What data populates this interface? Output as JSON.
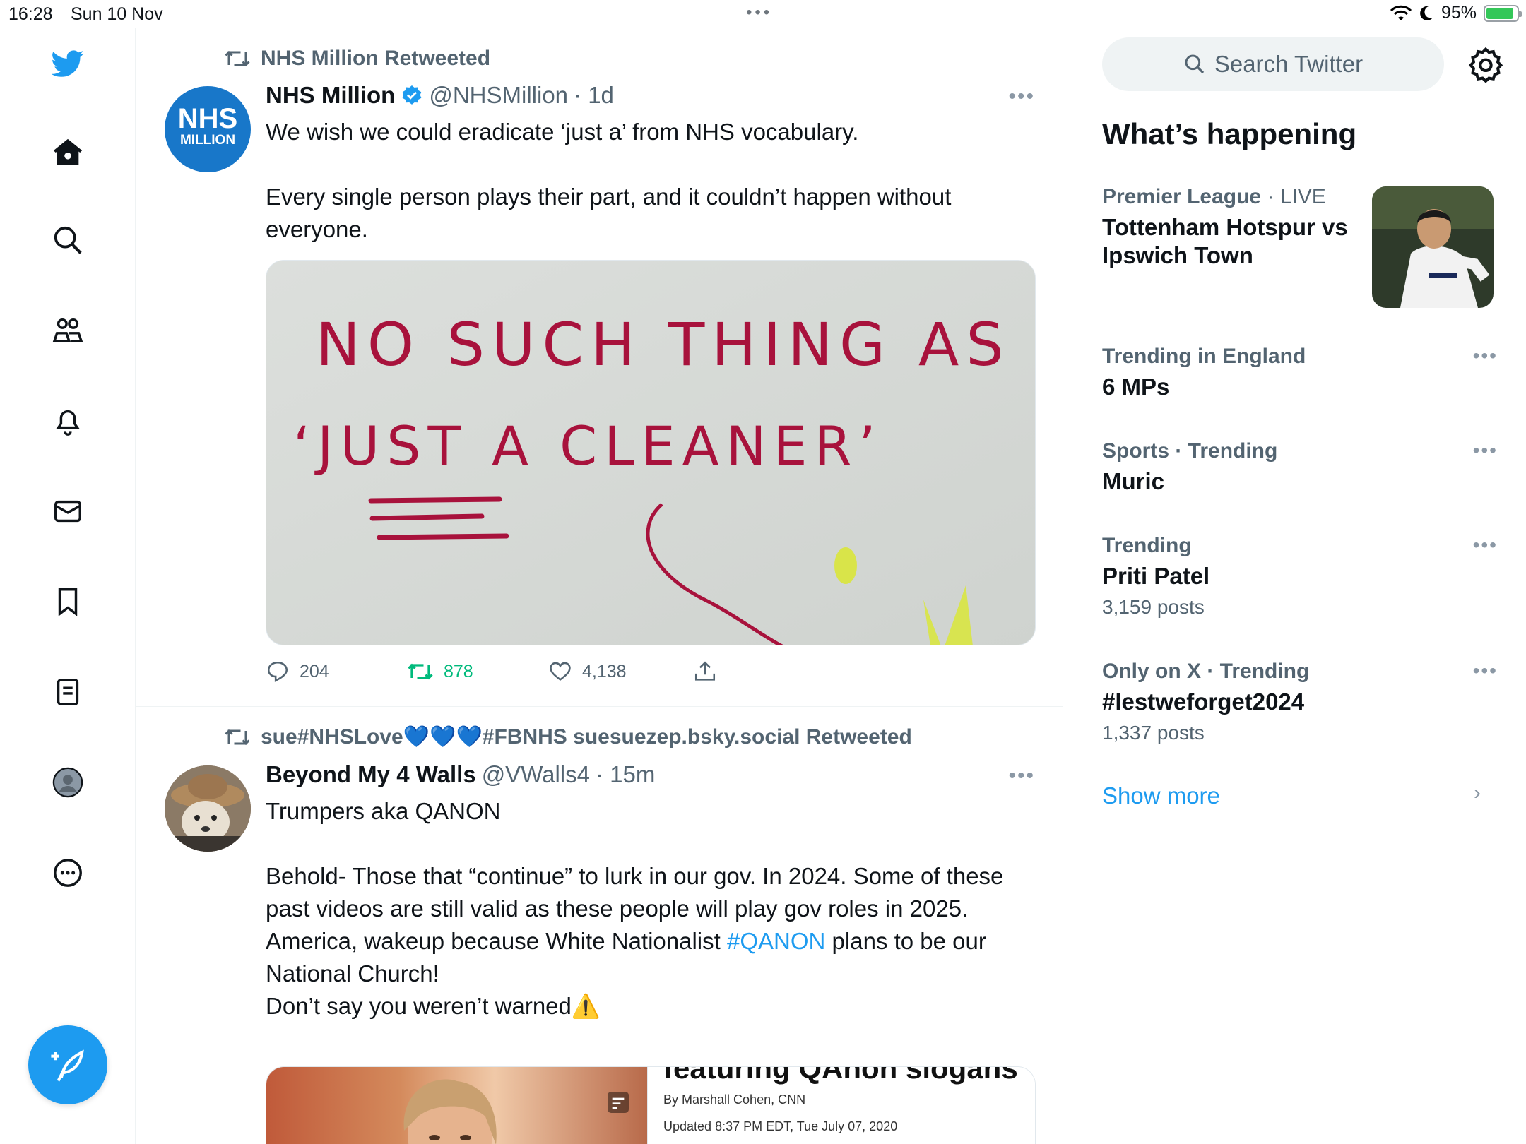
{
  "status_bar": {
    "time": "16:28",
    "date": "Sun 10 Nov",
    "battery": "95%",
    "battery_level": 0.95
  },
  "nav": {
    "items": [
      {
        "name": "home"
      },
      {
        "name": "explore"
      },
      {
        "name": "communities"
      },
      {
        "name": "notifications"
      },
      {
        "name": "messages"
      },
      {
        "name": "bookmarks"
      },
      {
        "name": "lists"
      },
      {
        "name": "profile"
      },
      {
        "name": "more"
      }
    ]
  },
  "tweets": [
    {
      "retweeted_by": "NHS Million Retweeted",
      "avatar_text_top": "NHS",
      "avatar_text_bottom": "MILLION",
      "name": "NHS Million",
      "verified": true,
      "handle": "@NHSMillion",
      "time": "· 1d",
      "text_p1": "We wish we could eradicate ‘just a’ from NHS vocabulary.",
      "text_p2": "Every single person plays their part, and it couldn’t happen without everyone.",
      "image_line1": "NO SUCH THING AS",
      "image_line2": "‘JUST A CLEANER’",
      "replies": "204",
      "retweets": "878",
      "likes": "4,138"
    },
    {
      "retweeted_by": "sue#NHSLove💙💙💙#FBNHS suesuezep.bsky.social Retweeted",
      "name": "Beyond My 4 Walls",
      "handle": "@VWalls4",
      "time": "· 15m",
      "text_p1": "Trumpers aka QANON",
      "text_p2_a": "Behold- Those that “continue” to lurk in our gov. In 2024. Some of these past videos are still valid as these people will play gov roles in 2025. America, wakeup because White Nationalist ",
      "hashtag": "#QANON",
      "text_p2_b": "  plans to be our National Church!",
      "text_p3": "Don’t say you weren’t warned⚠️",
      "article_headline": "featuring QAnon slogans",
      "article_byline": "By Marshall Cohen, CNN",
      "article_updated": "Updated 8:37 PM EDT, Tue July 07, 2020"
    }
  ],
  "sidebar": {
    "search_placeholder": "Search Twitter",
    "heading": "What’s happening",
    "trends": [
      {
        "meta_bold": "Premier League",
        "meta_rest": " · LIVE",
        "title": "Tottenham Hotspur vs Ipswich Town"
      },
      {
        "meta_bold": "Trending in England",
        "meta_rest": "",
        "title": "6 MPs"
      },
      {
        "meta_bold": "Sports · Trending",
        "meta_rest": "",
        "title": "Muric"
      },
      {
        "meta_bold": "Trending",
        "meta_rest": "",
        "title": "Priti Patel",
        "count": "3,159 posts"
      },
      {
        "meta_bold": "Only on X · Trending",
        "meta_rest": "",
        "title": "#lestweforget2024",
        "count": "1,337 posts"
      }
    ],
    "show_more": "Show more"
  }
}
